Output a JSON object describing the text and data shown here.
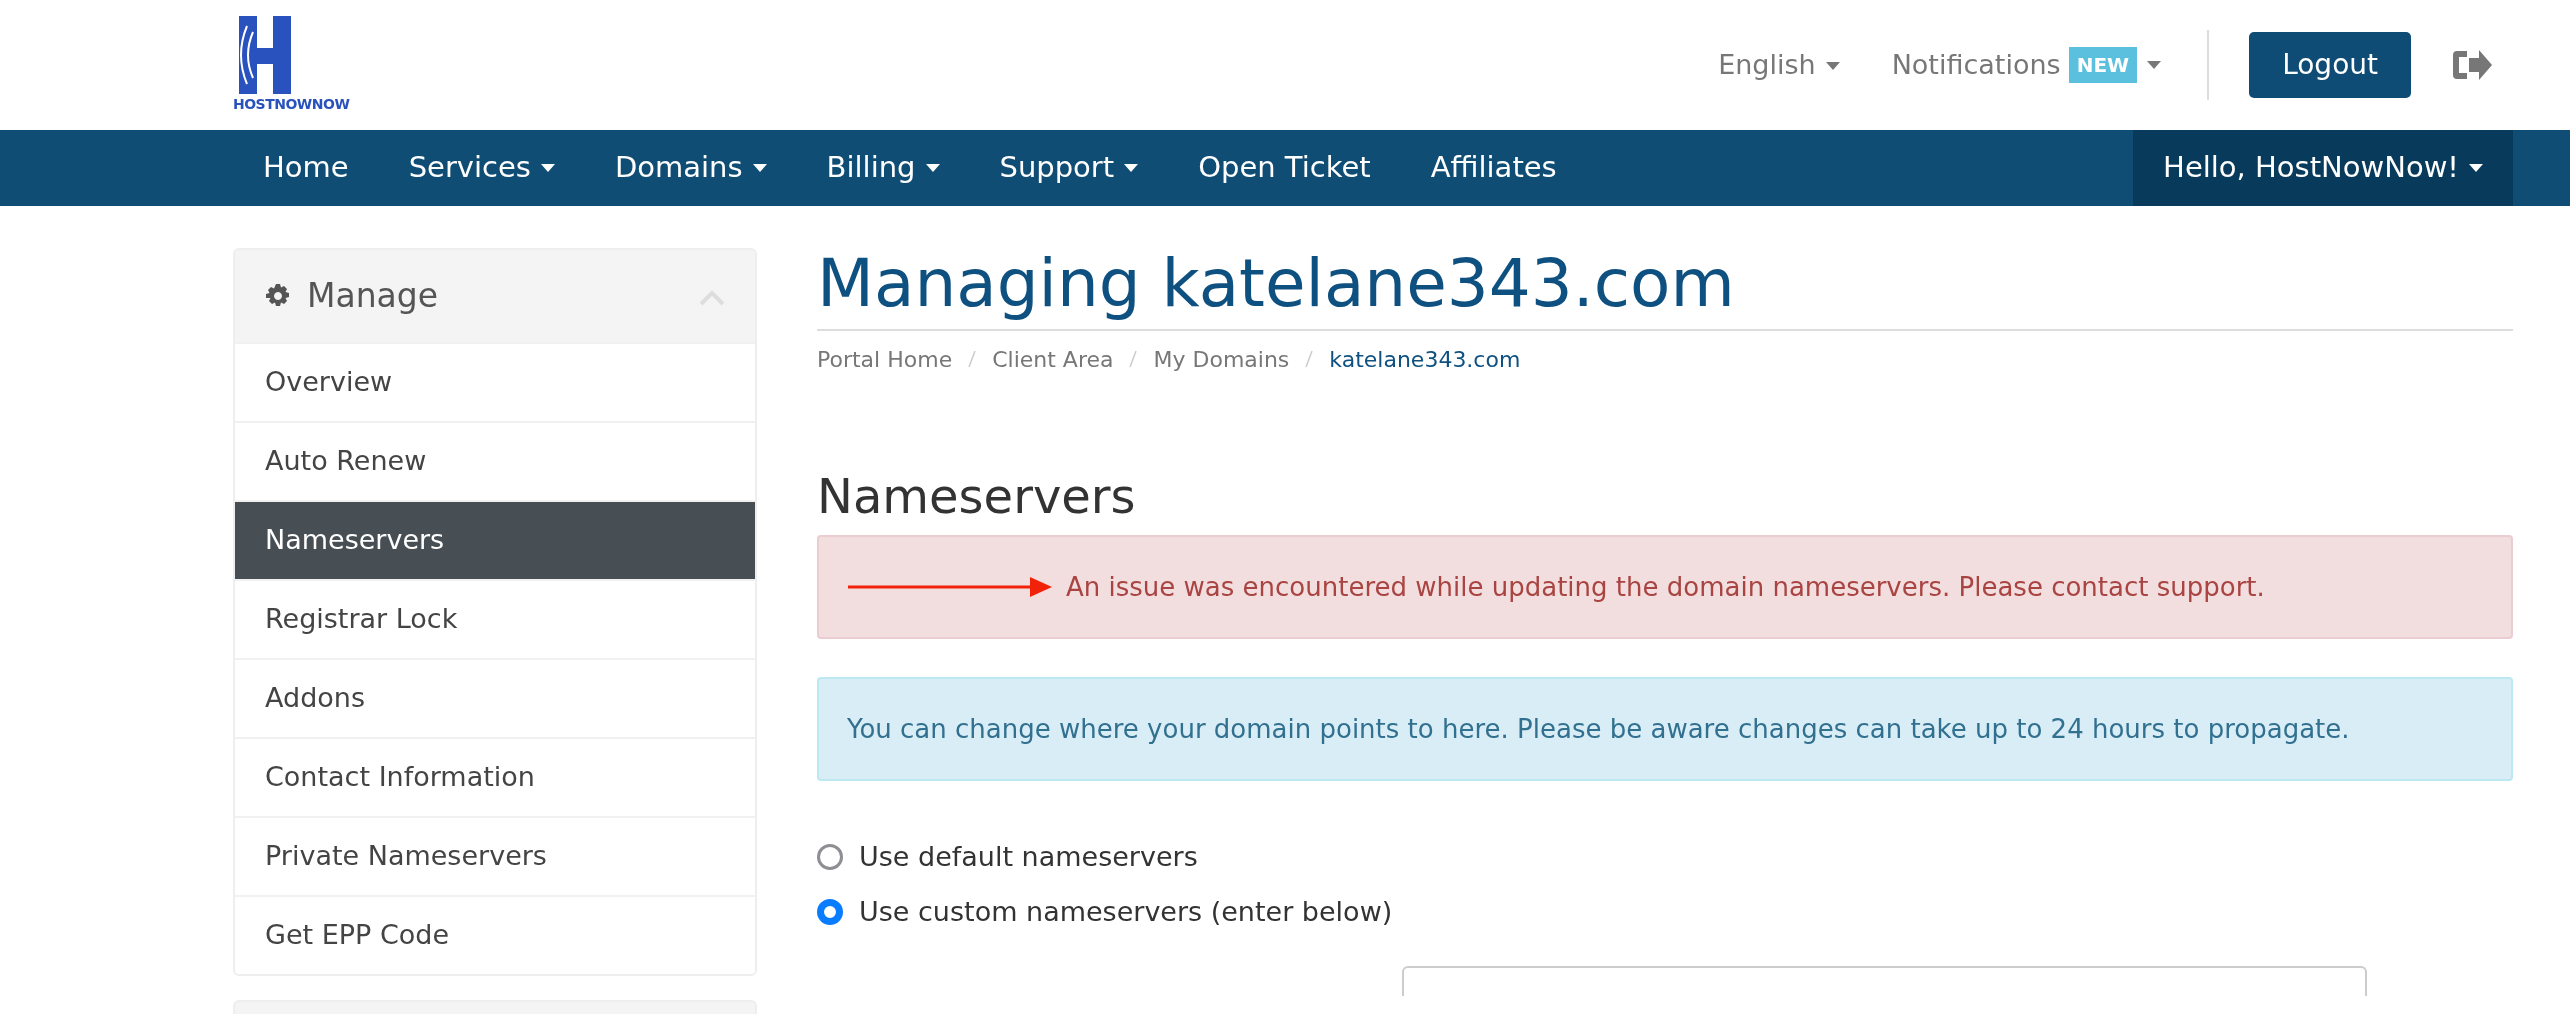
{
  "header": {
    "logo_text": "HOSTNOWNOW",
    "language": "English",
    "notifications": {
      "label": "Notifications",
      "badge": "NEW"
    },
    "logout": "Logout"
  },
  "nav": {
    "items": [
      {
        "label": "Home",
        "dropdown": false
      },
      {
        "label": "Services",
        "dropdown": true
      },
      {
        "label": "Domains",
        "dropdown": true
      },
      {
        "label": "Billing",
        "dropdown": true
      },
      {
        "label": "Support",
        "dropdown": true
      },
      {
        "label": "Open Ticket",
        "dropdown": false
      },
      {
        "label": "Affiliates",
        "dropdown": false
      }
    ],
    "user": "Hello, HostNowNow!"
  },
  "sidebar": {
    "title": "Manage",
    "expanded": true,
    "items": [
      {
        "label": "Overview",
        "selected": false
      },
      {
        "label": "Auto Renew",
        "selected": false
      },
      {
        "label": "Nameservers",
        "selected": true
      },
      {
        "label": "Registrar Lock",
        "selected": false
      },
      {
        "label": "Addons",
        "selected": false
      },
      {
        "label": "Contact Information",
        "selected": false
      },
      {
        "label": "Private Nameservers",
        "selected": false
      },
      {
        "label": "Get EPP Code",
        "selected": false
      }
    ]
  },
  "page": {
    "title": "Managing katelane343.com",
    "breadcrumb": [
      "Portal Home",
      "Client Area",
      "My Domains",
      "katelane343.com"
    ],
    "section": "Nameservers",
    "alerts": [
      {
        "kind": "danger",
        "text": "An issue was encountered while updating the domain nameservers. Please contact support."
      },
      {
        "kind": "info",
        "text": "You can change where your domain points to here. Please be aware changes can take up to 24 hours to propagate."
      }
    ],
    "options": [
      {
        "label": "Use default nameservers",
        "selected": false
      },
      {
        "label": "Use custom nameservers (enter below)",
        "selected": true
      }
    ]
  }
}
